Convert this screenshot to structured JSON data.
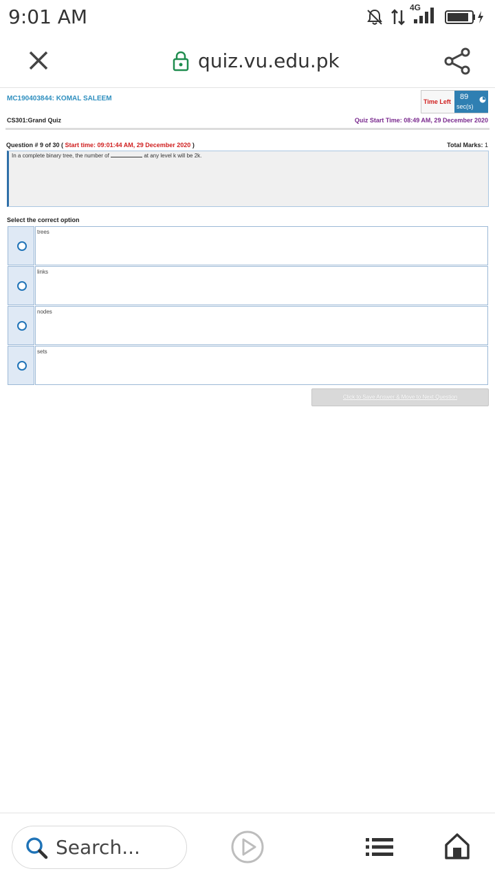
{
  "status_bar": {
    "time": "9:01 AM",
    "network_type": "4G"
  },
  "browser": {
    "url": "quiz.vu.edu.pk"
  },
  "quiz": {
    "student": "MC190403844: KOMAL SALEEM",
    "timer_label": "Time Left",
    "timer_seconds": "89",
    "timer_unit": "sec(s)",
    "course": "CS301:Grand Quiz",
    "quiz_start_time": "Quiz Start Time: 08:49 AM, 29 December 2020",
    "question_number": "Question # 9 of 30 (",
    "question_start_time": "Start time: 09:01:44 AM, 29 December 2020",
    "question_number_close": ")",
    "total_marks_label": "Total Marks:",
    "total_marks_value": "1",
    "question_text_before": "In a complete binary tree, the number of",
    "question_text_after": "at any level k will be 2k.",
    "select_label": "Select the correct option",
    "options": [
      {
        "label": "trees"
      },
      {
        "label": "links"
      },
      {
        "label": "nodes"
      },
      {
        "label": "sets"
      }
    ],
    "save_button_label": "Click to Save Answer & Move to Next Question"
  },
  "bottom_bar": {
    "search_placeholder": "Search..."
  },
  "colors": {
    "student_name": "#2f8fbf",
    "timer_bg": "#2f7fb2",
    "timer_label": "#d02020",
    "quiz_start": "#7a2a8e",
    "question_start": "#d02020",
    "radio": "#1f73b7"
  }
}
